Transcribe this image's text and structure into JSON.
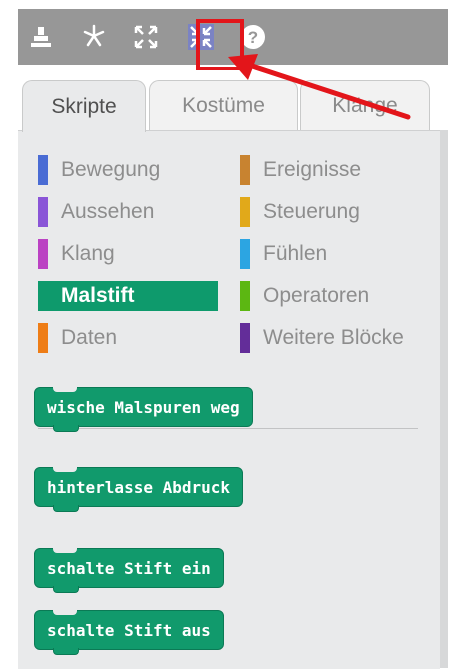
{
  "toolbar": {
    "icons": [
      "stamp-icon",
      "cut-icon",
      "grow-icon",
      "shrink-icon",
      "help-icon"
    ],
    "highlighted": "shrink-icon",
    "highlight_color": "#e3151a"
  },
  "tabs": [
    {
      "label": "Skripte",
      "active": true
    },
    {
      "label": "Kostüme",
      "active": false
    },
    {
      "label": "Klänge",
      "active": false
    }
  ],
  "categories": {
    "left": [
      {
        "label": "Bewegung",
        "color": "#4a6cd4"
      },
      {
        "label": "Aussehen",
        "color": "#8a55d7"
      },
      {
        "label": "Klang",
        "color": "#bb42c3"
      },
      {
        "label": "Malstift",
        "color": "#0e9a6c",
        "selected": true
      },
      {
        "label": "Daten",
        "color": "#ee7d16"
      }
    ],
    "right": [
      {
        "label": "Ereignisse",
        "color": "#c88330"
      },
      {
        "label": "Steuerung",
        "color": "#e1a91a"
      },
      {
        "label": "Fühlen",
        "color": "#2ca5e2"
      },
      {
        "label": "Operatoren",
        "color": "#5cb712"
      },
      {
        "label": "Weitere Blöcke",
        "color": "#632d99"
      }
    ]
  },
  "blocks": [
    {
      "label": "wische Malspuren weg"
    },
    {
      "label": "hinterlasse Abdruck"
    },
    {
      "label": "schalte Stift ein"
    },
    {
      "label": "schalte Stift aus"
    }
  ]
}
